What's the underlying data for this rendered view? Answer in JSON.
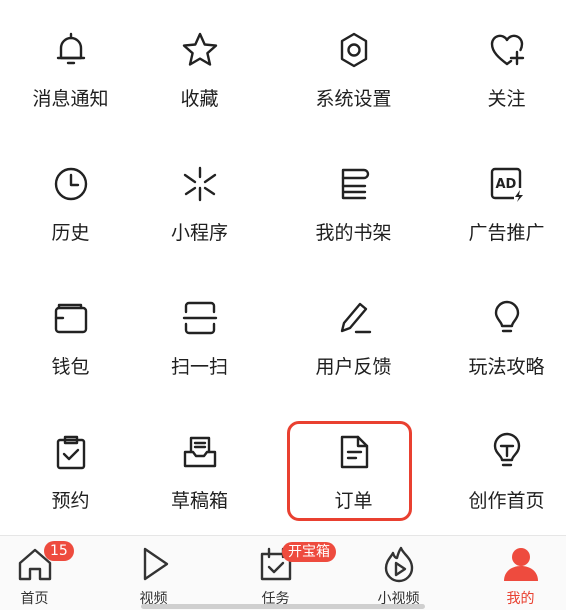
{
  "menu": {
    "items": [
      {
        "label": "消息通知",
        "icon": "bell-icon"
      },
      {
        "label": "收藏",
        "icon": "star-icon"
      },
      {
        "label": "系统设置",
        "icon": "gear-icon"
      },
      {
        "label": "关注",
        "icon": "heart-plus-icon"
      },
      {
        "label": "历史",
        "icon": "clock-icon"
      },
      {
        "label": "小程序",
        "icon": "mini-program-icon"
      },
      {
        "label": "我的书架",
        "icon": "bookshelf-icon"
      },
      {
        "label": "广告推广",
        "icon": "ad-icon"
      },
      {
        "label": "钱包",
        "icon": "wallet-icon"
      },
      {
        "label": "扫一扫",
        "icon": "scan-icon"
      },
      {
        "label": "用户反馈",
        "icon": "feedback-pen-icon"
      },
      {
        "label": "玩法攻略",
        "icon": "lightbulb-icon"
      },
      {
        "label": "预约",
        "icon": "clipboard-check-icon"
      },
      {
        "label": "草稿箱",
        "icon": "draft-box-icon"
      },
      {
        "label": "订单",
        "icon": "document-icon"
      },
      {
        "label": "创作首页",
        "icon": "creator-bulb-icon"
      }
    ]
  },
  "tabbar": {
    "home": {
      "label": "首页",
      "badge": "15",
      "icon": "home-icon"
    },
    "video": {
      "label": "视频",
      "icon": "play-icon"
    },
    "tasks": {
      "label": "任务",
      "badge": "开宝箱",
      "icon": "task-calendar-icon"
    },
    "short_video": {
      "label": "小视频",
      "icon": "flame-play-icon"
    },
    "mine": {
      "label": "我的",
      "icon": "person-icon"
    }
  },
  "colors": {
    "accent": "#e94030",
    "badge": "#ee4b3e",
    "text": "#1f1f1f"
  }
}
